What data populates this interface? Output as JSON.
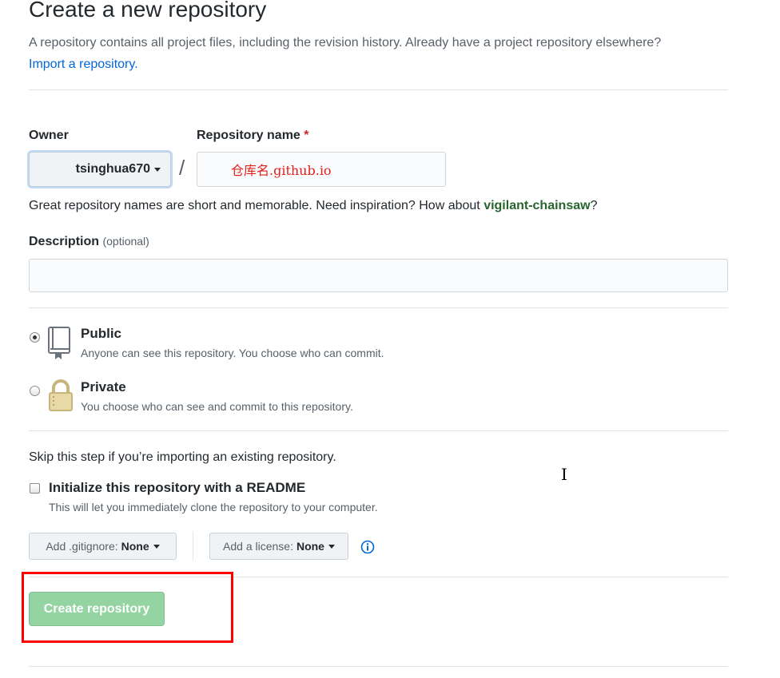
{
  "header": {
    "title": "Create a new repository",
    "description": "A repository contains all project files, including the revision history. Already have a project repository elsewhere?",
    "import_link": "Import a repository."
  },
  "owner": {
    "label": "Owner",
    "value": "tsinghua670"
  },
  "repo_name": {
    "label": "Repository name",
    "required_mark": "*",
    "separator": "/",
    "value": "仓库名.github.io"
  },
  "name_hint": {
    "prefix": "Great repository names are short and memorable. Need inspiration? How about ",
    "suggestion": "vigilant-chainsaw",
    "suffix": "?"
  },
  "description": {
    "label": "Description",
    "optional": "(optional)",
    "value": ""
  },
  "visibility": {
    "options": [
      {
        "title": "Public",
        "note": "Anyone can see this repository. You choose who can commit.",
        "checked": true
      },
      {
        "title": "Private",
        "note": "You choose who can see and commit to this repository.",
        "checked": false
      }
    ]
  },
  "init": {
    "skip_text": "Skip this step if you’re importing an existing repository.",
    "readme_title": "Initialize this repository with a README",
    "readme_note": "This will let you immediately clone the repository to your computer.",
    "readme_checked": false
  },
  "options": {
    "gitignore_label": "Add .gitignore:",
    "gitignore_value": "None",
    "license_label": "Add a license:",
    "license_value": "None"
  },
  "actions": {
    "create_label": "Create repository"
  },
  "colors": {
    "link": "#0366d6",
    "suggestion": "#28642e",
    "create_button": "#94d3a2",
    "annotation_box": "#ff0000"
  }
}
